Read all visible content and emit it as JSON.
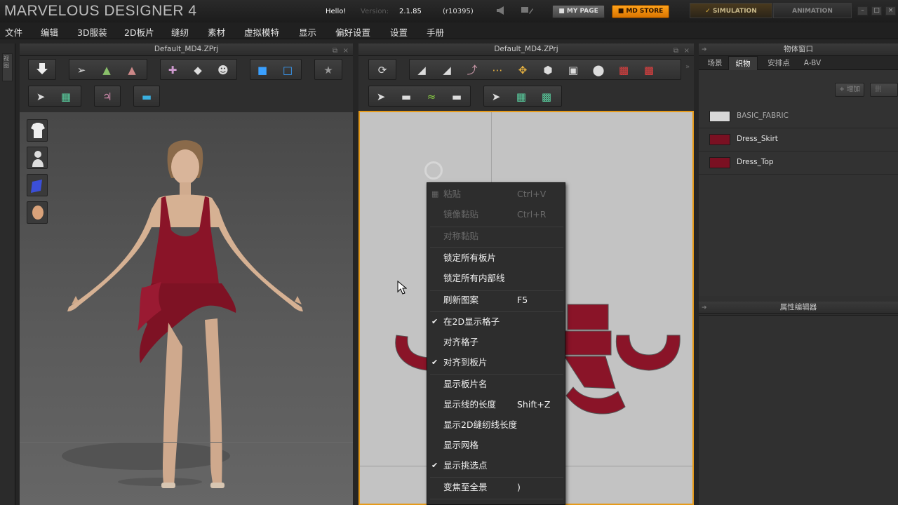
{
  "titlebar": {
    "app_title": "MARVELOUS DESIGNER 4",
    "hello": "Hello!",
    "version_label": "Version:",
    "version": "2.1.85",
    "build": "(r10395)",
    "mypage_label": "MY PAGE",
    "store_label": "MD STORE",
    "simulation_label": "SIMULATION",
    "animation_label": "ANIMATION"
  },
  "menubar": {
    "items": [
      "文件",
      "编辑",
      "3D服装",
      "2D板片",
      "缝纫",
      "素材",
      "虚拟模特",
      "显示",
      "偏好设置",
      "设置",
      "手册"
    ]
  },
  "left_strip": {
    "label": "视图"
  },
  "panel_3d": {
    "title": "Default_MD4.ZPrj"
  },
  "panel_2d": {
    "title": "Default_MD4.ZPrj"
  },
  "context_menu": {
    "items": [
      {
        "label": "粘贴",
        "shortcut": "Ctrl+V",
        "disabled": true,
        "checked": false
      },
      {
        "label": "镜像黏贴",
        "shortcut": "Ctrl+R",
        "disabled": true,
        "checked": false
      },
      {
        "label": "对称黏贴",
        "shortcut": "",
        "disabled": true,
        "checked": false
      },
      {
        "label": "锁定所有板片",
        "shortcut": "",
        "disabled": false,
        "checked": false
      },
      {
        "label": "锁定所有内部线",
        "shortcut": "",
        "disabled": false,
        "checked": false
      },
      {
        "label": "刷新图案",
        "shortcut": "F5",
        "disabled": false,
        "checked": false
      },
      {
        "label": "在2D显示格子",
        "shortcut": "",
        "disabled": false,
        "checked": true
      },
      {
        "label": "对齐格子",
        "shortcut": "",
        "disabled": false,
        "checked": false
      },
      {
        "label": "对齐到板片",
        "shortcut": "",
        "disabled": false,
        "checked": true
      },
      {
        "label": "显示板片名",
        "shortcut": "",
        "disabled": false,
        "checked": false
      },
      {
        "label": "显示线的长度",
        "shortcut": "Shift+Z",
        "disabled": false,
        "checked": false
      },
      {
        "label": "显示2D缝纫线长度",
        "shortcut": "",
        "disabled": false,
        "checked": false
      },
      {
        "label": "显示网格",
        "shortcut": "",
        "disabled": false,
        "checked": false
      },
      {
        "label": "显示挑选点",
        "shortcut": "",
        "disabled": false,
        "checked": true
      },
      {
        "label": "变焦至全景",
        "shortcut": ")",
        "disabled": false,
        "checked": false
      }
    ]
  },
  "object_window": {
    "title": "物体窗口",
    "tabs": [
      "场景",
      "织物",
      "安排点",
      "A-BV"
    ],
    "active_tab": "织物",
    "add_label": "增加",
    "delete_label": "删",
    "fabrics": [
      {
        "name": "BASIC_FABRIC",
        "color": "#d8d8d8"
      },
      {
        "name": "Dress_Skirt",
        "color": "#7a1022"
      },
      {
        "name": "Dress_Top",
        "color": "#7a1022"
      }
    ]
  },
  "property_editor": {
    "title": "属性编辑器"
  },
  "colors": {
    "accent": "#e59a1a",
    "dress": "#8a1428",
    "store": "#f08a0a"
  }
}
